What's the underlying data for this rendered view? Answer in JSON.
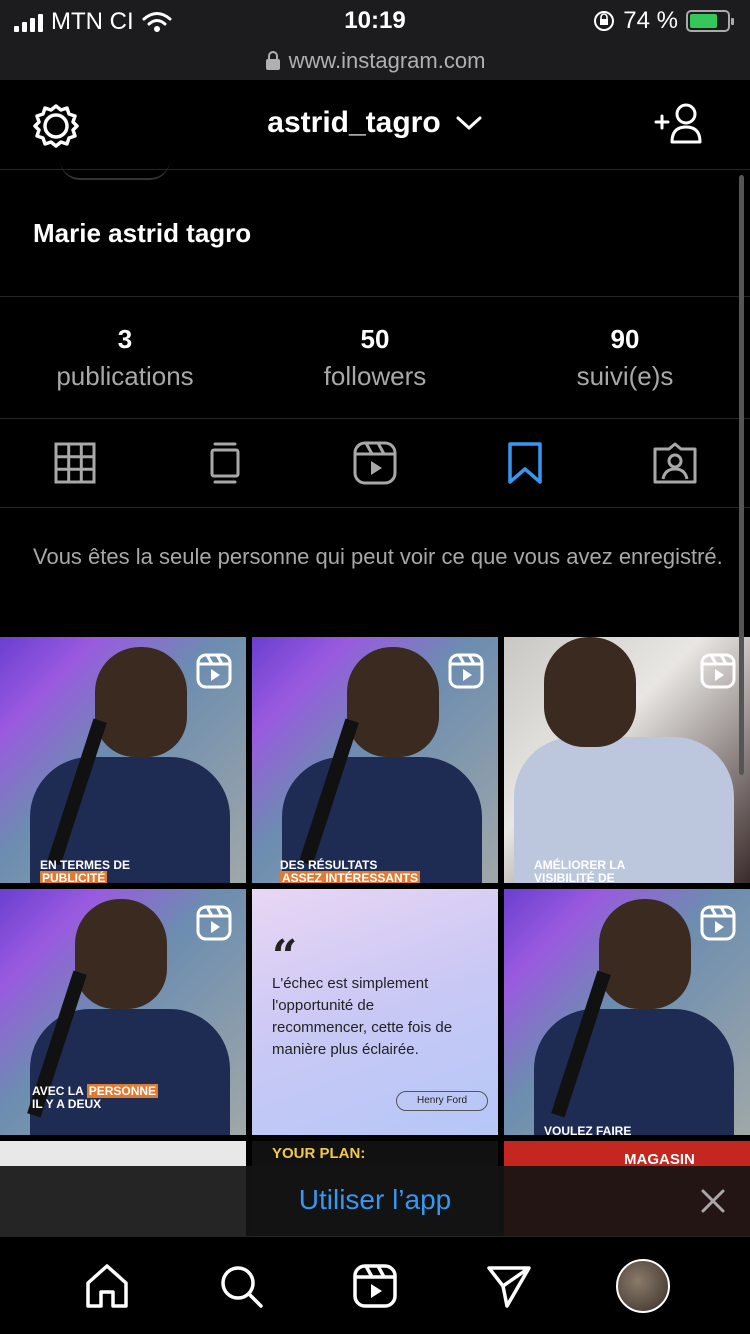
{
  "status_bar": {
    "carrier": "MTN CI",
    "time": "10:19",
    "battery_percent": "74 %",
    "battery_level": 0.74
  },
  "url_bar": {
    "url": "www.instagram.com"
  },
  "header": {
    "username": "astrid_tagro"
  },
  "profile": {
    "display_name": "Marie astrid tagro"
  },
  "stats": [
    {
      "value": "3",
      "label": "publications"
    },
    {
      "value": "50",
      "label": "followers"
    },
    {
      "value": "90",
      "label": "suivi(e)s"
    }
  ],
  "tabs": [
    {
      "icon": "grid-icon"
    },
    {
      "icon": "feed-icon"
    },
    {
      "icon": "reels-icon"
    },
    {
      "icon": "bookmark-icon",
      "active": true
    },
    {
      "icon": "tagged-icon"
    }
  ],
  "saved_note": "Vous êtes la seule personne qui peut voir ce que vous avez enregistré.",
  "posts": [
    {
      "caption_line1": "EN TERMES DE",
      "caption_line2": "PUBLICITÉ"
    },
    {
      "caption_line1": "DES RÉSULTATS",
      "caption_line2": "ASSEZ INTÉRESSANTS"
    },
    {
      "caption_line1": "AMÉLIORER LA",
      "caption_line2": "VISIBILITÉ DE"
    },
    {
      "caption_line1_a": "AVEC LA",
      "caption_line1_b": "PERSONNE",
      "caption_line2": "IL Y A DEUX"
    },
    {
      "quote": "L'échec est simplement l'opportunité de recommencer, cette fois de manière plus éclairée.",
      "author": "Henry Ford"
    },
    {
      "caption_line1": "VOULEZ FAIRE"
    },
    {
      "text": ""
    },
    {
      "text": "YOUR PLAN:"
    },
    {
      "text": "MAGASIN"
    }
  ],
  "app_banner": {
    "cta": "Utiliser l’app"
  },
  "colors": {
    "accent": "#3797f0",
    "battery": "#34c759",
    "background": "#000000"
  }
}
